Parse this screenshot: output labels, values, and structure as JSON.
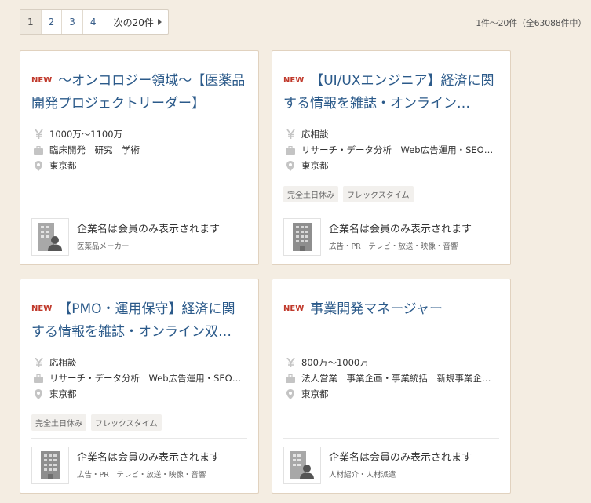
{
  "pager": {
    "pages": [
      "1",
      "2",
      "3",
      "4"
    ],
    "next_label": "次の20件"
  },
  "result_count": "1件〜20件（全63088件中）",
  "new_label": "NEW",
  "jobs": [
    {
      "title": "〜オンコロジー領域〜【医薬品開発プロジェクトリーダー】",
      "salary": "1000万〜1100万",
      "category": "臨床開発　研究　学術",
      "location": "東京都",
      "tags": [],
      "company_name": "企業名は会員のみ表示されます",
      "industry": "医薬品メーカー",
      "logo_icon": "person-building-icon"
    },
    {
      "title": "【UI/UXエンジニア】経済に関する情報を雑誌・オンライン…",
      "salary": "応相談",
      "category": "リサーチ・データ分析　Web広告運用・SEO…",
      "location": "東京都",
      "tags": [
        "完全土日休み",
        "フレックスタイム"
      ],
      "company_name": "企業名は会員のみ表示されます",
      "industry": "広告・PR　テレビ・放送・映像・音響",
      "logo_icon": "building-icon"
    },
    {
      "title": "【PMO・運用保守】経済に関する情報を雑誌・オンライン双…",
      "salary": "応相談",
      "category": "リサーチ・データ分析　Web広告運用・SEO…",
      "location": "東京都",
      "tags": [
        "完全土日休み",
        "フレックスタイム"
      ],
      "company_name": "企業名は会員のみ表示されます",
      "industry": "広告・PR　テレビ・放送・映像・音響",
      "logo_icon": "building-icon"
    },
    {
      "title": "事業開発マネージャー",
      "salary": "800万〜1000万",
      "category": "法人営業　事業企画・事業統括　新規事業企…",
      "location": "東京都",
      "tags": [],
      "company_name": "企業名は会員のみ表示されます",
      "industry": "人材紹介・人材派遣",
      "logo_icon": "person-building-icon"
    }
  ]
}
